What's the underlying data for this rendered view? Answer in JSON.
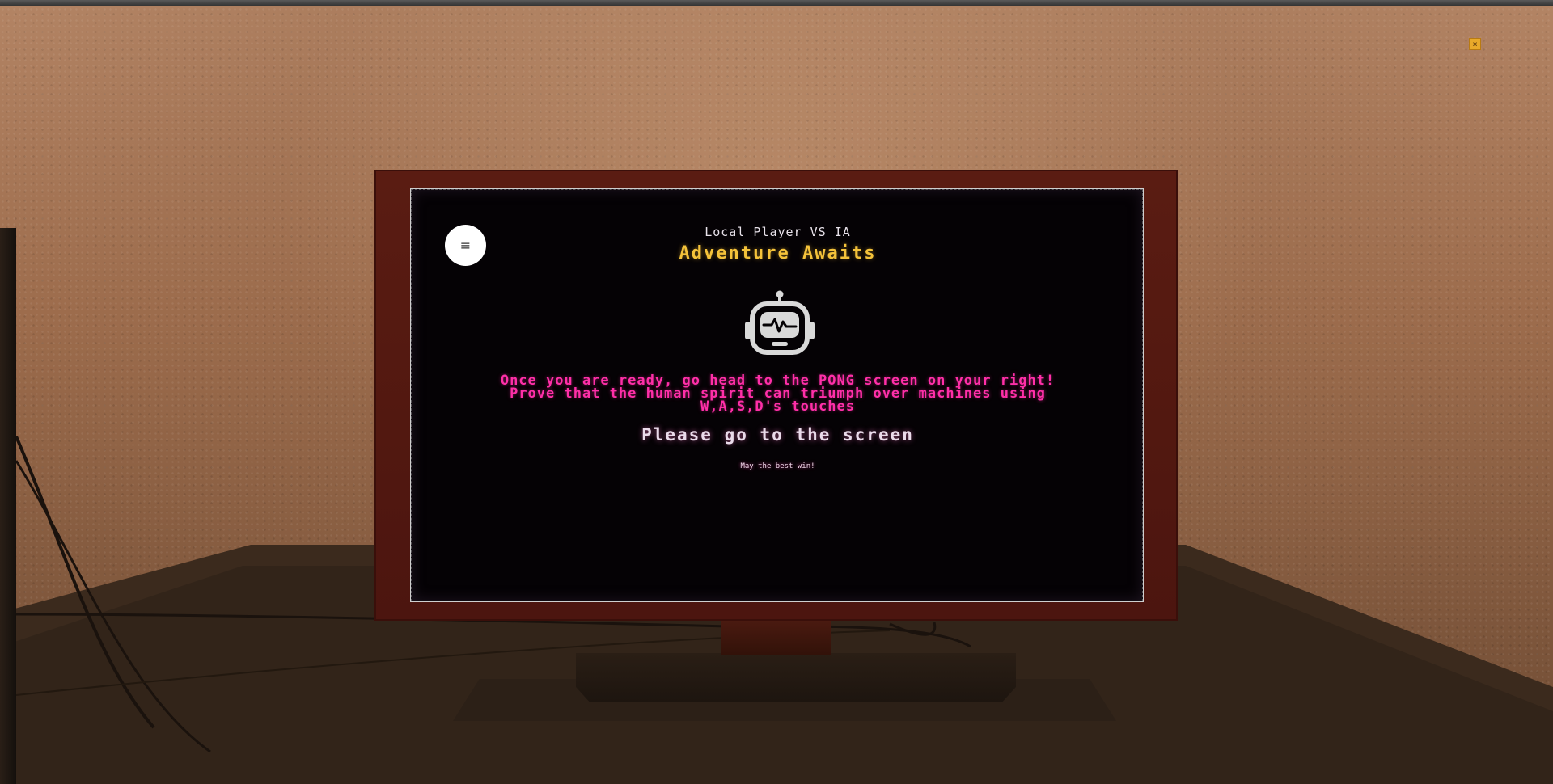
{
  "close_button": {
    "icon": "close-icon",
    "glyph": "×"
  },
  "menu_button": {
    "icon": "hamburger-menu-icon",
    "glyph": "≡"
  },
  "screen": {
    "mode_label": "Local Player VS IA",
    "title": "Adventure Awaits",
    "robot_icon": "robot-head-icon",
    "message_lines": [
      "Once you are ready, go head to the PONG screen on your right!",
      "Prove that the human spirit can triumph over machines using",
      "W,A,S,D's touches"
    ],
    "cta": "Please go to the screen",
    "sub": "May the best win!"
  },
  "colors": {
    "title": "#f4c23a",
    "message": "#ff2fa8",
    "cta": "#eadbea",
    "frame": "#4c150f",
    "close": "#e8a92a"
  }
}
